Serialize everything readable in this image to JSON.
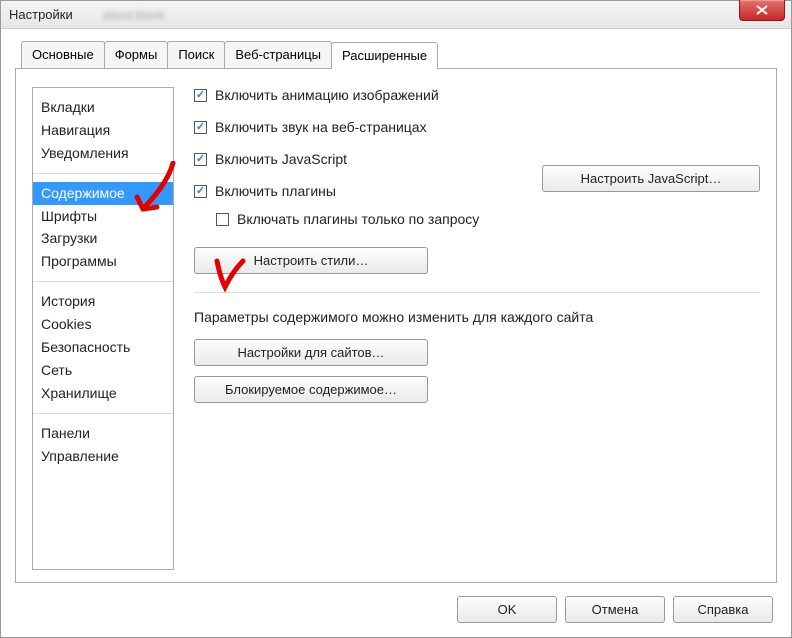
{
  "window": {
    "title": "Настройки",
    "blurred_url": "about:blank"
  },
  "tabs": [
    {
      "label": "Основные",
      "active": false
    },
    {
      "label": "Формы",
      "active": false
    },
    {
      "label": "Поиск",
      "active": false
    },
    {
      "label": "Веб-страницы",
      "active": false
    },
    {
      "label": "Расширенные",
      "active": true
    }
  ],
  "sidebar": {
    "group1": [
      {
        "label": "Вкладки",
        "selected": false
      },
      {
        "label": "Навигация",
        "selected": false
      },
      {
        "label": "Уведомления",
        "selected": false
      }
    ],
    "group2": [
      {
        "label": "Содержимое",
        "selected": true
      },
      {
        "label": "Шрифты",
        "selected": false
      },
      {
        "label": "Загрузки",
        "selected": false
      },
      {
        "label": "Программы",
        "selected": false
      }
    ],
    "group3": [
      {
        "label": "История",
        "selected": false
      },
      {
        "label": "Cookies",
        "selected": false
      },
      {
        "label": "Безопасность",
        "selected": false
      },
      {
        "label": "Сеть",
        "selected": false
      },
      {
        "label": "Хранилище",
        "selected": false
      }
    ],
    "group4": [
      {
        "label": "Панели",
        "selected": false
      },
      {
        "label": "Управление",
        "selected": false
      }
    ]
  },
  "content": {
    "cb_anim": {
      "label": "Включить анимацию изображений",
      "checked": true
    },
    "cb_sound": {
      "label": "Включить звук на веб-страницах",
      "checked": true
    },
    "cb_js": {
      "label": "Включить JavaScript",
      "checked": true
    },
    "btn_js": "Настроить JavaScript…",
    "cb_plugins": {
      "label": "Включить плагины",
      "checked": true
    },
    "cb_plugins_on_demand": {
      "label": "Включать плагины только по запросу",
      "checked": false
    },
    "btn_styles": "Настроить стили…",
    "param_text": "Параметры содержимого можно изменить для каждого сайта",
    "btn_sites": "Настройки для сайтов…",
    "btn_blocked": "Блокируемое содержимое…"
  },
  "buttons": {
    "ok": "OK",
    "cancel": "Отмена",
    "help": "Справка"
  }
}
